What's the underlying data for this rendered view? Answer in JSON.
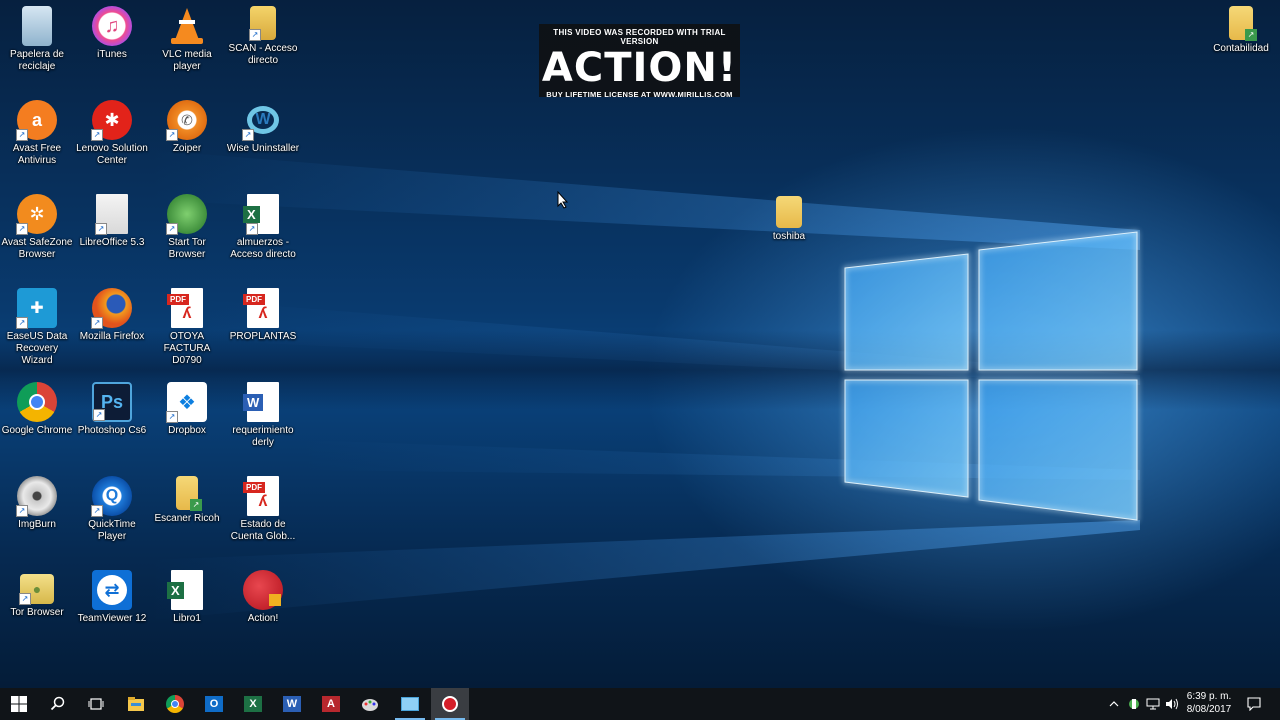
{
  "watermark": {
    "top": "THIS VIDEO WAS RECORDED WITH TRIAL VERSION",
    "main": "ACTION!",
    "bottom": "BUY LIFETIME LICENSE AT WWW.MIRILLIS.COM"
  },
  "desktop_icons": {
    "papelera": "Papelera de reciclaje",
    "itunes": "iTunes",
    "vlc": "VLC media player",
    "scan": "SCAN - Acceso directo",
    "avast": "Avast Free Antivirus",
    "lenovo": "Lenovo Solution Center",
    "zoiper": "Zoiper",
    "wise": "Wise Uninstaller",
    "avast_safezone": "Avast SafeZone Browser",
    "libreoffice": "LibreOffice 5.3",
    "start_tor": "Start Tor Browser",
    "almuerzos": "almuerzos - Acceso directo",
    "easeus": "EaseUS Data Recovery Wizard",
    "firefox": "Mozilla Firefox",
    "otoya": "OTOYA FACTURA D0790",
    "proplantas": "PROPLANTAS",
    "chrome": "Google Chrome",
    "photoshop": "Photoshop Cs6",
    "dropbox": "Dropbox",
    "requerimiento": "requerimiento derly",
    "imgburn": "ImgBurn",
    "quicktime": "QuickTime Player",
    "escaner": "Escaner Ricoh",
    "estado": "Estado de Cuenta Glob...",
    "tor_browser": "Tor Browser",
    "teamviewer": "TeamViewer 12",
    "libro1": "Libro1",
    "action": "Action!",
    "toshiba": "toshiba",
    "contabilidad": "Contabilidad"
  },
  "taskbar": {
    "time": "6:39 p. m.",
    "date": "8/08/2017"
  },
  "colors": {
    "taskbar": "#101418",
    "accent": "#76b9ed",
    "wallpaper": "#0a447f"
  }
}
